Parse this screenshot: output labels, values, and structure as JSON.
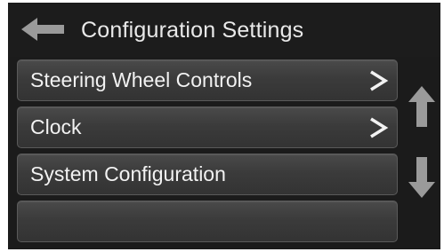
{
  "header": {
    "title": "Configuration Settings",
    "back_icon": "back-arrow-icon"
  },
  "menu": {
    "items": [
      {
        "label": "Steering Wheel Controls",
        "has_submenu": true
      },
      {
        "label": "Clock",
        "has_submenu": true
      },
      {
        "label": "System Configuration",
        "has_submenu": false
      },
      {
        "label": "",
        "has_submenu": false
      }
    ]
  },
  "scroll": {
    "up_icon": "arrow-up-icon",
    "down_icon": "arrow-down-icon"
  },
  "colors": {
    "background": "#1b1b1b",
    "row": "#3b3b3b",
    "text": "#f2f2f2",
    "icon": "#9a9a9a"
  }
}
